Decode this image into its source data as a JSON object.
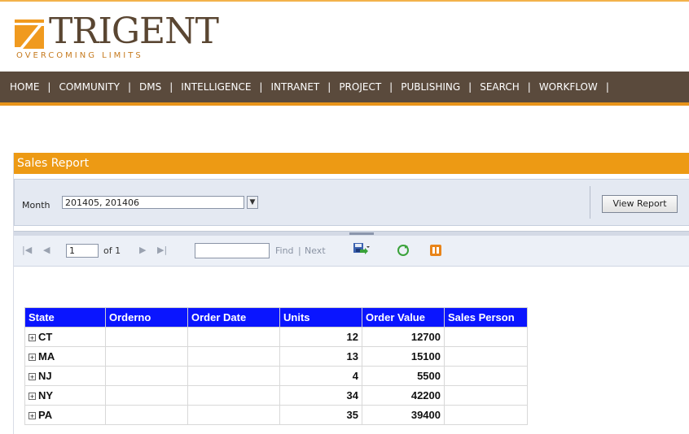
{
  "brand": {
    "name": "TRIGENT",
    "tagline": "OVERCOMING LIMITS",
    "accent_color": "#f09a1f",
    "text_color": "#5a4632"
  },
  "nav": {
    "items": [
      "HOME",
      "COMMUNITY",
      "DMS",
      "INTELLIGENCE",
      "INTRANET",
      "PROJECT",
      "PUBLISHING",
      "SEARCH",
      "WORKFLOW"
    ],
    "separator": "|",
    "background_color": "#5a4a3c"
  },
  "report": {
    "title": "Sales Report",
    "title_color": "#ed9a14",
    "params": {
      "month_label": "Month",
      "month_value": "201405, 201406",
      "view_button": "View Report"
    },
    "toolbar": {
      "page_value": "1",
      "of_label": "of 1",
      "find_label": "Find",
      "link_separator": "|",
      "next_label": "Next",
      "icons": [
        "first-page-icon",
        "prev-page-icon",
        "next-page-icon",
        "last-page-icon",
        "save-export-icon",
        "refresh-icon",
        "document-map-icon"
      ]
    },
    "table": {
      "header_color": "#0a15ff",
      "columns": [
        "State",
        "Orderno",
        "Order Date",
        "Units",
        "Order Value",
        "Sales Person"
      ],
      "rows": [
        {
          "state": "CT",
          "orderno": "",
          "order_date": "",
          "units": "12",
          "order_value": "12700",
          "sales_person": ""
        },
        {
          "state": "MA",
          "orderno": "",
          "order_date": "",
          "units": "13",
          "order_value": "15100",
          "sales_person": ""
        },
        {
          "state": "NJ",
          "orderno": "",
          "order_date": "",
          "units": "4",
          "order_value": "5500",
          "sales_person": ""
        },
        {
          "state": "NY",
          "orderno": "",
          "order_date": "",
          "units": "34",
          "order_value": "42200",
          "sales_person": ""
        },
        {
          "state": "PA",
          "orderno": "",
          "order_date": "",
          "units": "35",
          "order_value": "39400",
          "sales_person": ""
        }
      ]
    }
  }
}
